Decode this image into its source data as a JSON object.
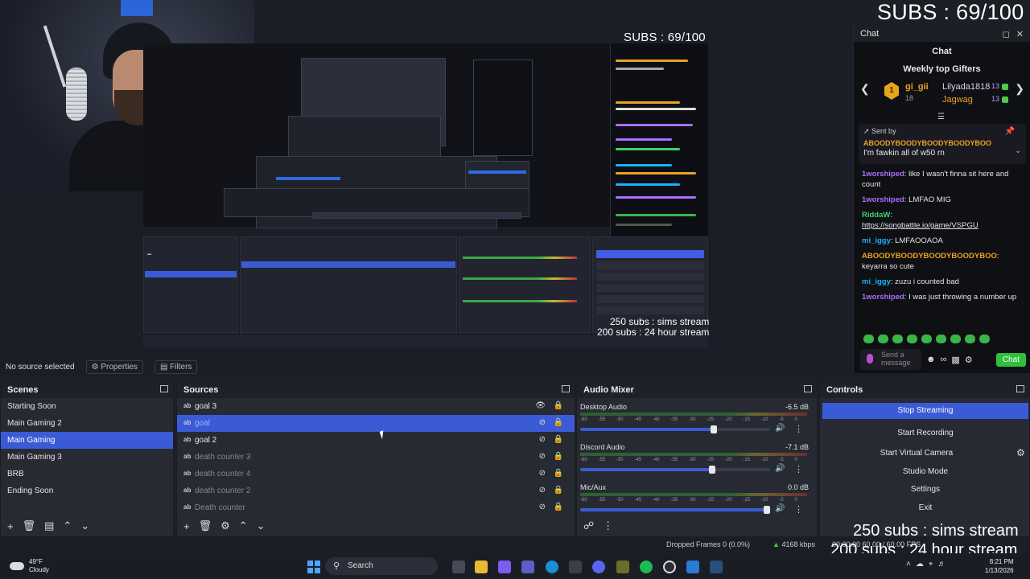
{
  "overlay": {
    "subs_top": "SUBS : 69/100",
    "subs_nested": "SUBS : 69/100",
    "sims": "250 subs : sims stream",
    "hour24": "200 subs : 24 hour stream",
    "nested_sims": "250 subs : sims stream",
    "nested_hour": "200 subs : 24 hour stream"
  },
  "chat": {
    "window_title": "Chat",
    "subtitle": "Chat",
    "gifters_title": "Weekly top Gifters",
    "gifters": [
      {
        "name": "gi_gii",
        "count": "18"
      },
      {
        "name": "Lilyada1818",
        "count": "13"
      },
      {
        "name": "Jagwag",
        "count": "13"
      }
    ],
    "pinned_label": "Sent by",
    "pinned_user": "ABOODYBOODYBOODYBOODYBOO",
    "pinned_message": "I'm fawkin all of w50 rn",
    "messages": [
      {
        "user": "1worshiped",
        "text": ": like I wasn't finna sit here and count",
        "color": "#a970ff"
      },
      {
        "user": "1worshiped",
        "text": ": LMFAO MIG",
        "color": "#a970ff"
      },
      {
        "user": "RiddaW",
        "text": ":",
        "link": "https://songbattle.io/game/VSPGU",
        "color": "#3fd26a"
      },
      {
        "user": "mi_iggy",
        "text": ": LMFAOOAOA",
        "color": "#1ab2ff"
      },
      {
        "user": "ABOODYBOODYBOODYBOODYBOO",
        "text": ": keyarra so cute",
        "color": "#e9a321"
      },
      {
        "user": "mi_iggy",
        "text": ": zuzu i counted bad",
        "color": "#1ab2ff"
      },
      {
        "user": "1worshiped",
        "text": ": I was just throwing a number up",
        "color": "#a970ff"
      }
    ],
    "input_placeholder": "Send a message",
    "send_label": "Chat"
  },
  "context": {
    "no_source": "No source selected",
    "properties": "Properties",
    "filters": "Filters"
  },
  "scenes": {
    "title": "Scenes",
    "items": [
      "Starting Soon",
      "Main Gaming 2",
      "Main Gaming",
      "Main Gaming 3",
      "BRB",
      "Ending Soon"
    ],
    "selected": "Main Gaming"
  },
  "sources": {
    "title": "Sources",
    "items": [
      "goal 3",
      "goal",
      "goal 2",
      "death counter 3",
      "death counter 4",
      "death counter 2",
      "Death counter"
    ],
    "selected": "goal"
  },
  "mixer": {
    "title": "Audio Mixer",
    "channels": [
      {
        "name": "Desktop Audio",
        "db": "-6.5 dB",
        "level": 0.72
      },
      {
        "name": "Discord Audio",
        "db": "-7.1 dB",
        "level": 0.71
      },
      {
        "name": "Mic/Aux",
        "db": "0.0 dB",
        "level": 1.0
      }
    ],
    "ticks": [
      "-60",
      "-55",
      "-50",
      "-45",
      "-40",
      "-35",
      "-30",
      "-25",
      "-20",
      "-15",
      "-10",
      "-5",
      "0"
    ]
  },
  "controls": {
    "title": "Controls",
    "stop_streaming": "Stop Streaming",
    "start_recording": "Start Recording",
    "start_virtual_camera": "Start Virtual Camera",
    "studio_mode": "Studio Mode",
    "settings": "Settings",
    "exit": "Exit"
  },
  "status": {
    "dropped": "Dropped Frames 0 (0.0%)",
    "bitrate": "4168 kbps",
    "timecode": "00:00:00  60.00 / 60.00 FPS"
  },
  "taskbar": {
    "temp": "49°F",
    "weather": "Cloudy",
    "search": "Search",
    "time": "8:21 PM",
    "date": "1/13/2026"
  },
  "colors": {
    "accent": "#3b5bd6",
    "chat_send": "#2fbf3a"
  }
}
